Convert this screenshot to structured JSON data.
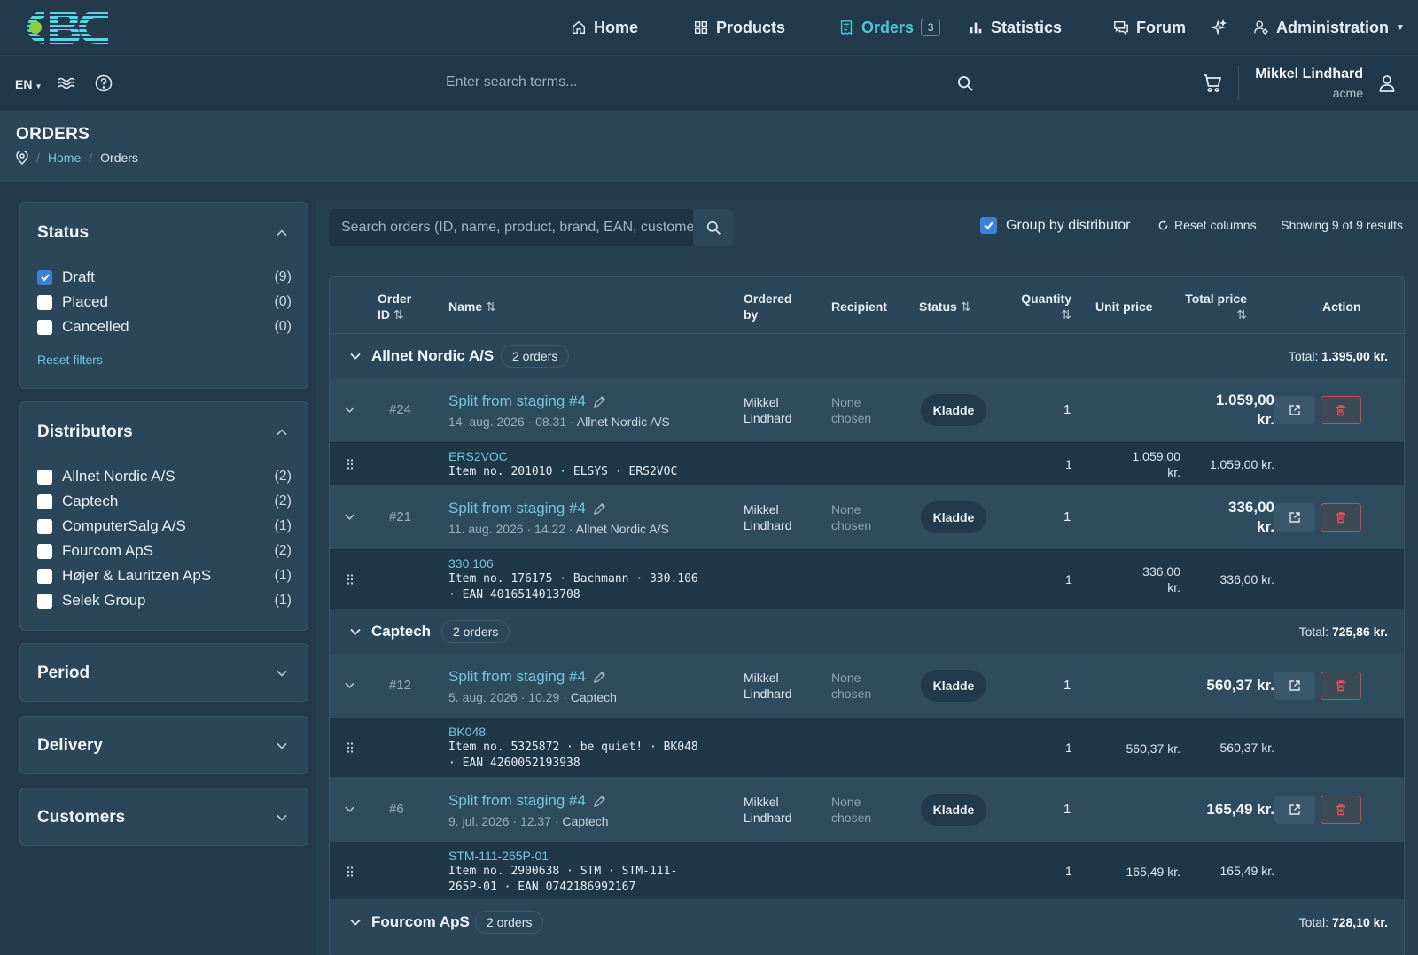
{
  "nav": {
    "home": "Home",
    "products": "Products",
    "orders": "Orders",
    "orders_badge": "3",
    "statistics": "Statistics",
    "forum": "Forum",
    "administration": "Administration"
  },
  "header": {
    "lang": "EN",
    "search_placeholder": "Enter search terms...",
    "user_name": "Mikkel Lindhard",
    "user_company": "acme"
  },
  "page": {
    "title": "ORDERS",
    "breadcrumb": [
      "Home",
      "Orders"
    ]
  },
  "filters": {
    "status": {
      "title": "Status",
      "items": [
        {
          "label": "Draft",
          "count": "(9)",
          "checked": true
        },
        {
          "label": "Placed",
          "count": "(0)",
          "checked": false
        },
        {
          "label": "Cancelled",
          "count": "(0)",
          "checked": false
        }
      ],
      "reset": "Reset filters"
    },
    "distributors": {
      "title": "Distributors",
      "items": [
        {
          "label": "Allnet Nordic A/S",
          "count": "(2)"
        },
        {
          "label": "Captech",
          "count": "(2)"
        },
        {
          "label": "ComputerSalg A/S",
          "count": "(1)"
        },
        {
          "label": "Fourcom ApS",
          "count": "(2)"
        },
        {
          "label": "Højer & Lauritzen ApS",
          "count": "(1)"
        },
        {
          "label": "Selek Group",
          "count": "(1)"
        }
      ]
    },
    "period": "Period",
    "delivery": "Delivery",
    "customers": "Customers"
  },
  "toolbar": {
    "search_placeholder": "Search orders (ID, name, product, brand, EAN, customer)",
    "group_by": "Group by distributor",
    "reset_columns": "Reset columns",
    "showing": "Showing 9 of 9 results"
  },
  "table": {
    "headers": {
      "order_id_1": "Order",
      "order_id_2": "ID",
      "name": "Name",
      "ordered_by_1": "Ordered",
      "ordered_by_2": "by",
      "recipient": "Recipient",
      "status": "Status",
      "quantity": "Quantity",
      "unit_price": "Unit price",
      "total_price": "Total price",
      "action": "Action"
    },
    "groups": [
      {
        "name": "Allnet Nordic A/S",
        "count": "2 orders",
        "total_label": "Total:",
        "total": "1.395,00 kr."
      },
      {
        "name": "Captech",
        "count": "2 orders",
        "total_label": "Total:",
        "total": "725,86 kr."
      },
      {
        "name": "Fourcom ApS",
        "count": "2 orders",
        "total_label": "Total:",
        "total": "728,10 kr."
      }
    ],
    "orders": [
      {
        "id": "#24",
        "name": "Split from staging #4",
        "date": "14. aug. 2026 · 08.31 ·",
        "dist": "Allnet Nordic A/S",
        "by1": "Mikkel",
        "by2": "Lindhard",
        "rec1": "None",
        "rec2": "chosen",
        "status": "Kladde",
        "qty": "1",
        "total1": "1.059,00",
        "total2": "kr.",
        "item": {
          "sku": "ERS2VOC",
          "desc": "Item no. 201010 · ELSYS · ERS2VOC",
          "qty": "1",
          "unit1": "1.059,00",
          "unit2": "kr.",
          "total": "1.059,00 kr."
        }
      },
      {
        "id": "#21",
        "name": "Split from staging #4",
        "date": "11. aug. 2026 · 14.22 ·",
        "dist": "Allnet Nordic A/S",
        "by1": "Mikkel",
        "by2": "Lindhard",
        "rec1": "None",
        "rec2": "chosen",
        "status": "Kladde",
        "qty": "1",
        "total1": "336,00",
        "total2": "kr.",
        "item": {
          "sku": "330.106",
          "desc": "Item no. 176175 · Bachmann · 330.106\n· EAN 4016514013708",
          "qty": "1",
          "unit1": "336,00",
          "unit2": "kr.",
          "total": "336,00 kr."
        }
      },
      {
        "id": "#12",
        "name": "Split from staging #4",
        "date": "5. aug. 2026 · 10.29 ·",
        "dist": "Captech",
        "by1": "Mikkel",
        "by2": "Lindhard",
        "rec1": "None",
        "rec2": "chosen",
        "status": "Kladde",
        "qty": "1",
        "total1": "560,37 kr.",
        "item": {
          "sku": "BK048",
          "desc": "Item no. 5325872 · be quiet! · BK048\n· EAN 4260052193938",
          "qty": "1",
          "unit1": "560,37 kr.",
          "total": "560,37 kr."
        }
      },
      {
        "id": "#6",
        "name": "Split from staging #4",
        "date": "9. jul. 2026 · 12.37 ·",
        "dist": "Captech",
        "by1": "Mikkel",
        "by2": "Lindhard",
        "rec1": "None",
        "rec2": "chosen",
        "status": "Kladde",
        "qty": "1",
        "total1": "165,49 kr.",
        "item": {
          "sku": "STM-111-265P-01",
          "desc": "Item no. 2900638 · STM · STM-111-\n265P-01 · EAN 0742186992167",
          "qty": "1",
          "unit1": "165,49 kr.",
          "total": "165,49 kr."
        }
      }
    ]
  },
  "colors": {
    "accent": "#4fc3d9",
    "link": "#74c6e0",
    "danger": "#d24848",
    "checkbox": "#3b82d6"
  }
}
